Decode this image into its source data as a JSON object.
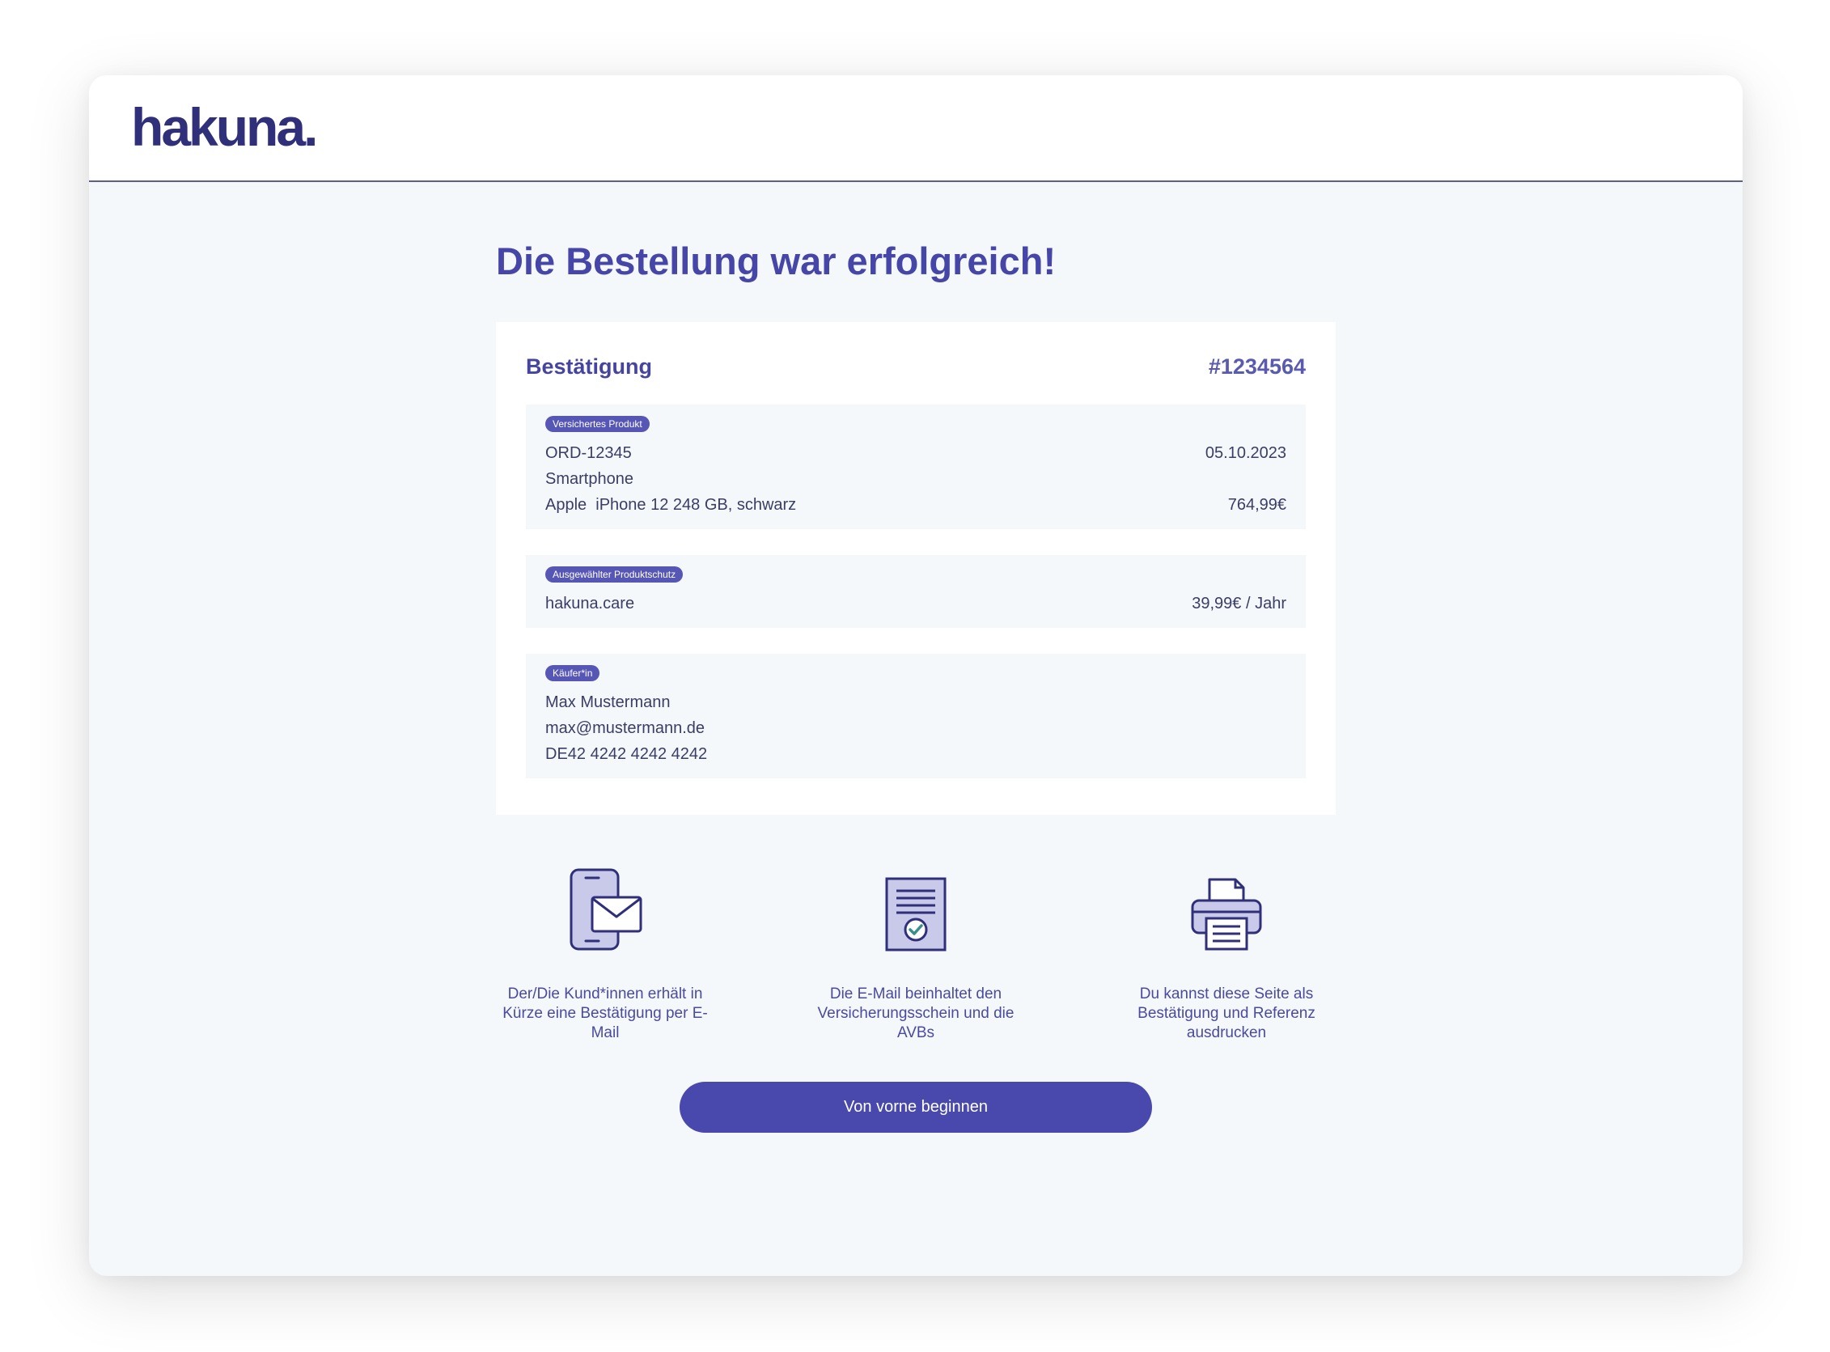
{
  "brand": {
    "logo_text": "hakuna."
  },
  "page": {
    "title": "Die Bestellung war erfolgreich!"
  },
  "confirmation": {
    "title": "Bestätigung",
    "reference": "#1234564",
    "product": {
      "badge": "Versichertes Produkt",
      "order_id": "ORD-12345",
      "date": "05.10.2023",
      "category": "Smartphone",
      "device": "Apple  iPhone 12 248 GB, schwarz",
      "price": "764,99€"
    },
    "protection": {
      "badge": "Ausgewählter Produktschutz",
      "name": "hakuna.care",
      "price": "39,99€ / Jahr"
    },
    "buyer": {
      "badge": "Käufer*in",
      "name": "Max Mustermann",
      "email": "max@mustermann.de",
      "iban": "DE42 4242 4242 4242"
    }
  },
  "features": [
    {
      "icon": "phone-mail-icon",
      "text": "Der/Die Kund*innen erhält in Kürze eine Bestätigung per E-Mail"
    },
    {
      "icon": "document-check-icon",
      "text": "Die E-Mail beinhaltet den Versicherungsschein und die AVBs"
    },
    {
      "icon": "printer-icon",
      "text": "Du kannst diese Seite als Bestätigung und Referenz ausdrucken"
    }
  ],
  "actions": {
    "restart_label": "Von vorne beginnen"
  },
  "colors": {
    "accent": "#4848ad",
    "logo": "#302f7a",
    "icon_fill": "#c9c9ea",
    "background": "#f5f8fb"
  }
}
